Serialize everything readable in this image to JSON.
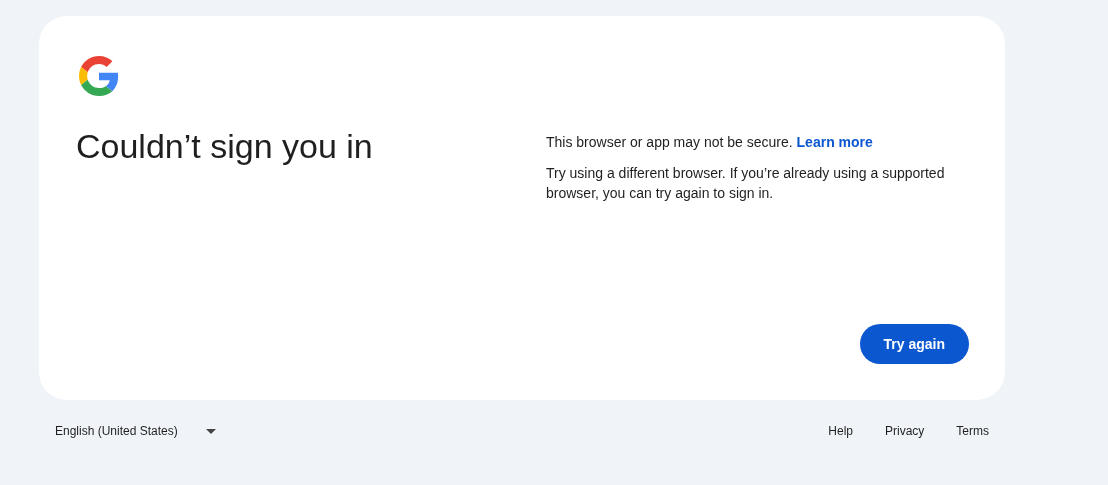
{
  "card": {
    "heading": "Couldn’t sign you in",
    "message": "This browser or app may not be secure.",
    "learn_more": "Learn more",
    "hint": "Try using a different browser. If you’re already using a supported browser, you can try again to sign in.",
    "button": "Try again"
  },
  "footer": {
    "language": "English (United States)",
    "links": [
      "Help",
      "Privacy",
      "Terms"
    ]
  }
}
